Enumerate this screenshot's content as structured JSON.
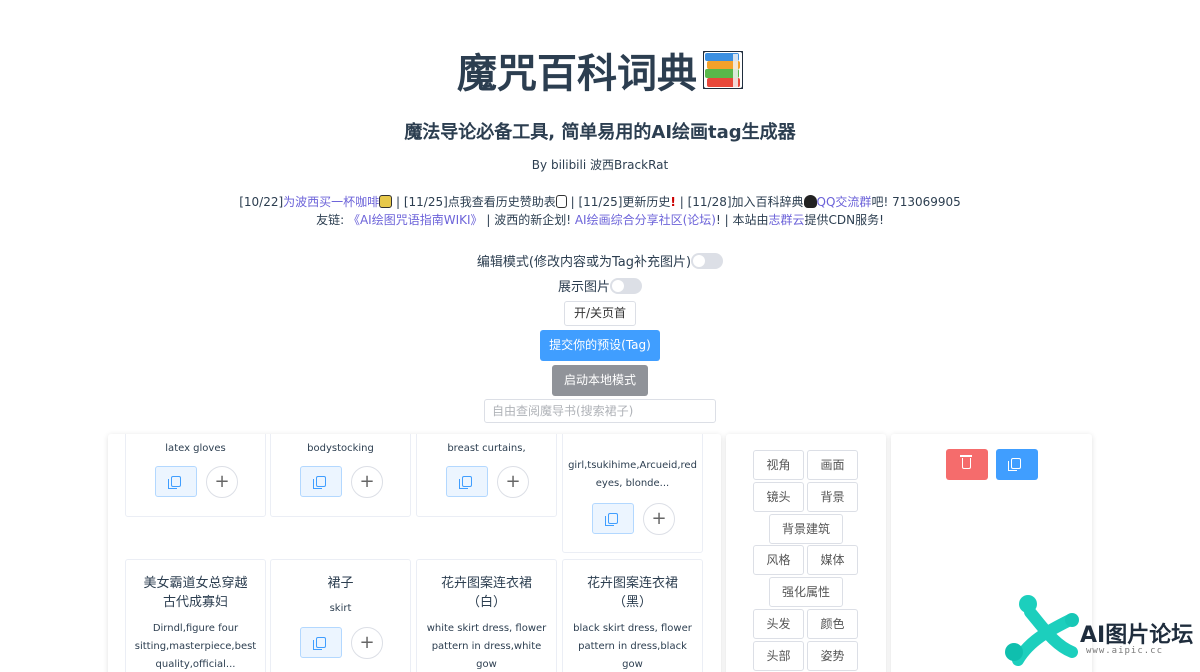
{
  "header": {
    "title": "魔咒百科词典",
    "subtitle": "魔法导论必备工具, 简单易用的AI绘画tag生成器",
    "author": "By bilibili 波西BrackRat"
  },
  "links": {
    "line1": [
      {
        "text": "[10/22]",
        "link": false
      },
      {
        "text": "为波西买一杯咖啡",
        "link": true
      },
      {
        "text": " | [11/25]点我查看历史赞助表",
        "link": false
      },
      {
        "text": " | [11/25]更新历史",
        "link": false
      },
      {
        "text": " | [11/28]加入百科辞典",
        "link": false
      },
      {
        "text": "QQ交流群",
        "link": true
      },
      {
        "text": "吧! 713069905",
        "link": false
      }
    ],
    "line2": [
      {
        "text": "友链: ",
        "link": false
      },
      {
        "text": "《AI绘图咒语指南WIKI》",
        "link": true
      },
      {
        "text": " | 波西的新企划! ",
        "link": false
      },
      {
        "text": "AI绘画综合分享社区(论坛)",
        "link": true
      },
      {
        "text": "! | 本站由",
        "link": false
      },
      {
        "text": "志群云",
        "link": true
      },
      {
        "text": "提供CDN服务!",
        "link": false
      }
    ]
  },
  "controls": {
    "edit_mode_label": "编辑模式(修改内容或为Tag补充图片)",
    "show_images_label": "展示图片",
    "toggle_header_button": "开/关页首",
    "submit_preset_button": "提交你的预设(Tag)",
    "local_mode_button": "启动本地模式",
    "search_placeholder": "自由查阅魔导书(搜索裙子)"
  },
  "cards": [
    {
      "name": "",
      "tag": "latex gloves"
    },
    {
      "name": "",
      "tag": "bodystocking"
    },
    {
      "name": "",
      "tag": "breast curtains,"
    },
    {
      "name": "",
      "tag_lines": [
        "girl,tsukihime,Arcueid,red",
        "eyes, blonde..."
      ]
    },
    {
      "name": "美女霸道女总穿越古代成寡妇",
      "tag_lines": [
        "Dirndl,figure four",
        "sitting,masterpiece,best",
        "quality,official..."
      ]
    },
    {
      "name": "裙子",
      "tag": "skirt"
    },
    {
      "name": "花卉图案连衣裙（白）",
      "tag_lines": [
        "white skirt dress, flower",
        "pattern in dress,white",
        "gow"
      ]
    },
    {
      "name": "花卉图案连衣裙（黑）",
      "tag_lines": [
        "black skirt dress, flower",
        "pattern in dress,black",
        "gow"
      ]
    }
  ],
  "categories": [
    "视角",
    "画面",
    "镜头",
    "背景",
    "背景建筑",
    "风格",
    "媒体",
    "强化属性",
    "头发",
    "颜色",
    "头部",
    "姿势"
  ],
  "watermark": {
    "text": "AI图片论坛",
    "url": "www.aipic.cc"
  },
  "colors": {
    "primary": "#409eff",
    "danger": "#f56c6c",
    "info": "#909399",
    "link": "#6c63d9",
    "text": "#2c3e50"
  }
}
